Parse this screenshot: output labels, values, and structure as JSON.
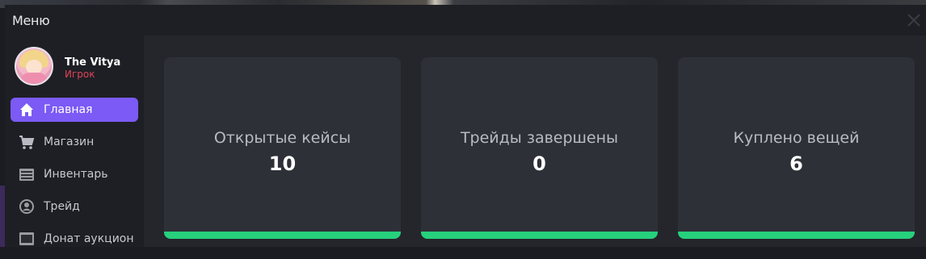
{
  "window": {
    "title": "Меню"
  },
  "profile": {
    "name": "The Vitya",
    "role": "Игрок"
  },
  "sidebar": {
    "items": [
      {
        "label": "Главная",
        "icon": "home-icon",
        "active": true
      },
      {
        "label": "Магазин",
        "icon": "cart-icon",
        "active": false
      },
      {
        "label": "Инвентарь",
        "icon": "inventory-icon",
        "active": false
      },
      {
        "label": "Трейд",
        "icon": "trade-icon",
        "active": false
      },
      {
        "label": "Донат аукцион",
        "icon": "auction-icon",
        "active": false
      }
    ]
  },
  "stats": [
    {
      "label": "Открытые кейсы",
      "value": "10"
    },
    {
      "label": "Трейды завершены",
      "value": "0"
    },
    {
      "label": "Куплено вещей",
      "value": "6"
    }
  ],
  "colors": {
    "accent": "#7b5af5",
    "role": "#e0435a",
    "progress": "#26d07c"
  }
}
